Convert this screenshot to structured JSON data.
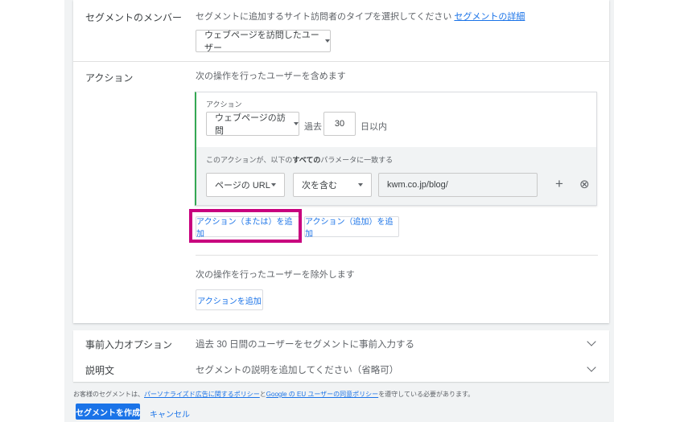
{
  "members": {
    "label": "セグメントのメンバー",
    "desc": "セグメントに追加するサイト訪問者のタイプを選択してください",
    "details_link": "セグメントの詳細",
    "type_dropdown": "ウェブページを訪問したユーザー"
  },
  "actions": {
    "label": "アクション",
    "include_desc": "次の操作を行ったユーザーを含めます",
    "box": {
      "title": "アクション",
      "visit_dropdown": "ウェブページの訪問",
      "past_label": "過去",
      "days_value": "30",
      "days_suffix": "日以内",
      "param_prefix": "このアクションが、以下の",
      "param_bold": "すべての",
      "param_suffix": "パラメータに一致する",
      "param_dropdown": "ページの URL",
      "match_dropdown": "次を含む",
      "url_value": "kwm.co.jp/blog/",
      "add_symbol": "+",
      "remove_symbol": "⊗"
    },
    "add_or_button": "アクション（または）を追加",
    "add_and_button": "アクション（追加）を追加",
    "exclude_desc": "次の操作を行ったユーザーを除外します",
    "add_action_button": "アクションを追加"
  },
  "prefill": {
    "label": "事前入力オプション",
    "desc": "過去 30 日間のユーザーをセグメントに事前入力する"
  },
  "description": {
    "label": "説明文",
    "desc": "セグメントの説明を追加してください（省略可）"
  },
  "footer": {
    "note_prefix": "お客様のセグメントは、",
    "policy_link1": "パーソナライズド広告に関するポリシー",
    "note_and": "と",
    "policy_link2": "Google の EU ユーザーの同意ポリシー",
    "note_suffix": "を遵守している必要があります。",
    "create_button": "セグメントを作成",
    "cancel_button": "キャンセル"
  },
  "colors": {
    "accent": "#1a73e8",
    "highlight": "#c8007e",
    "action_border": "#34a853"
  }
}
